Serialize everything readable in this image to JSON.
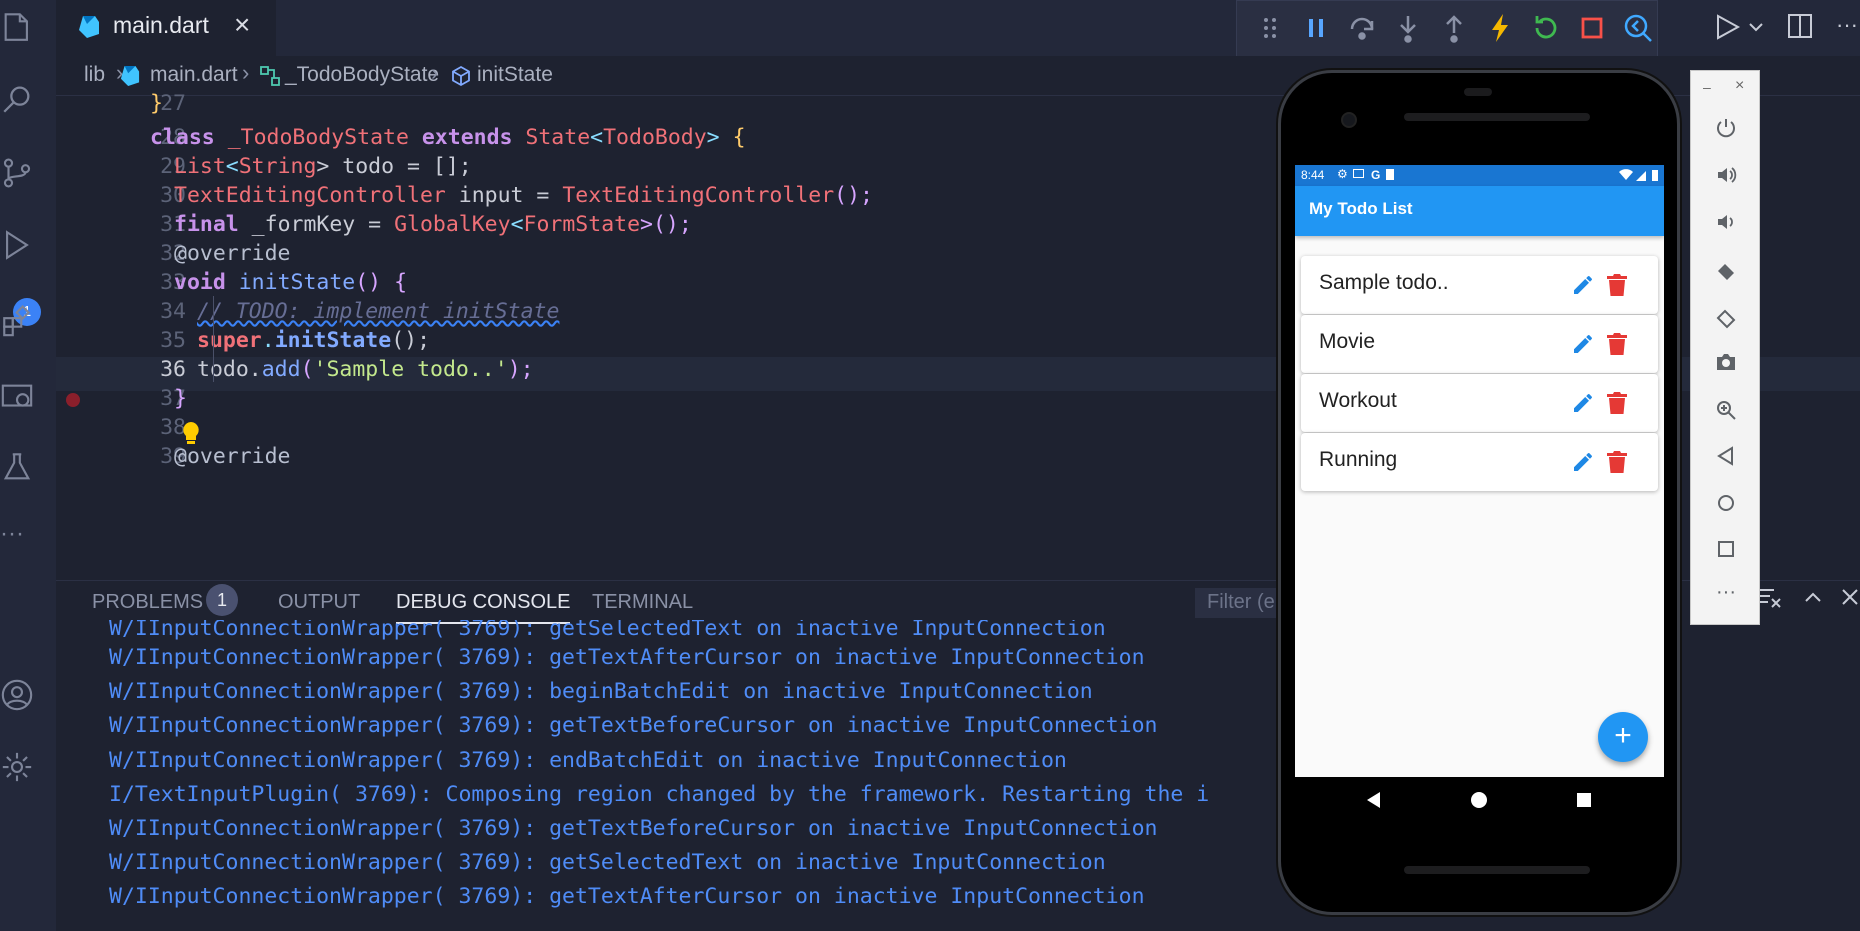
{
  "tab": {
    "file": "main.dart",
    "close": "×"
  },
  "breadcrumb": {
    "items": [
      "lib",
      "main.dart",
      "_TodoBodyState",
      "initState"
    ]
  },
  "activity": {
    "debug_badge": "1"
  },
  "editor": {
    "lines": [
      {
        "n": "27"
      },
      {
        "n": "28"
      },
      {
        "n": "29"
      },
      {
        "n": "30"
      },
      {
        "n": "31"
      },
      {
        "n": "32"
      },
      {
        "n": "33"
      },
      {
        "n": "34"
      },
      {
        "n": "35"
      },
      {
        "n": "36"
      },
      {
        "n": "37"
      },
      {
        "n": "38"
      },
      {
        "n": "39"
      }
    ],
    "code": {
      "l27": "}",
      "l28_kw": "class",
      "l28_cls": "_TodoBodyState",
      "l28_kw2": "extends",
      "l28_state": "State",
      "l28_lt": "<",
      "l28_body": "TodoBody",
      "l28_gt": ">",
      "l28_brace": "{",
      "l29_list": "List",
      "l29_lt": "<",
      "l29_str": "String",
      "l29_rest": "> todo = [];",
      "l30_type": "TextEditingController",
      "l30_mid": " input = ",
      "l30_ctor": "TextEditingController",
      "l30_end": "();",
      "l31_kw": "final",
      "l31_mid": " _formKey = ",
      "l31_gk": "GlobalKey",
      "l31_lt": "<",
      "l31_fs": "FormState",
      "l31_end": ">();",
      "l32": "@override",
      "l33_kw": "void",
      "l33_fn": "initState",
      "l33_end": "() {",
      "l34": "// TODO: implement initState",
      "l35_sup": "super",
      "l35_dot": ".",
      "l35_fn": "initState",
      "l35_end": "();",
      "l36_obj": "todo.",
      "l36_fn": "add",
      "l36_open": "(",
      "l36_str": "'Sample todo..'",
      "l36_end": ");",
      "l37": "}",
      "l39": "@override"
    }
  },
  "panel": {
    "tabs": [
      "PROBLEMS",
      "OUTPUT",
      "DEBUG CONSOLE",
      "TERMINAL"
    ],
    "problems_count": "1",
    "filter_placeholder": "Filter (e",
    "console": [
      "W/IInputConnectionWrapper( 3769): getSelectedText on inactive InputConnection",
      "W/IInputConnectionWrapper( 3769): getTextAfterCursor on inactive InputConnection",
      "W/IInputConnectionWrapper( 3769): beginBatchEdit on inactive InputConnection",
      "W/IInputConnectionWrapper( 3769): getTextBeforeCursor on inactive InputConnection",
      "W/IInputConnectionWrapper( 3769): endBatchEdit on inactive InputConnection",
      "I/TextInputPlugin( 3769): Composing region changed by the framework. Restarting the i",
      "W/IInputConnectionWrapper( 3769): getTextBeforeCursor on inactive InputConnection",
      "W/IInputConnectionWrapper( 3769): getSelectedText on inactive InputConnection",
      "W/IInputConnectionWrapper( 3769): getTextAfterCursor on inactive InputConnection"
    ]
  },
  "phone": {
    "time": "8:44",
    "status_g": "G",
    "app_title": "My Todo List",
    "todos": [
      "Sample todo..",
      "Movie",
      "Workout",
      "Running"
    ],
    "fab": "+"
  },
  "emulator": {
    "minimize": "–",
    "close": "×",
    "more": "···"
  },
  "colors": {
    "accent": "#2196f3",
    "delete": "#e53935",
    "console_text": "#4f8cf7"
  }
}
